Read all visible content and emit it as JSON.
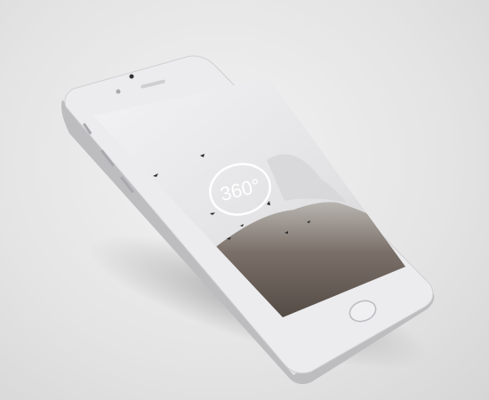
{
  "screen": {
    "badge_text": "360°"
  },
  "colors": {
    "body": "#e8e8ea",
    "bezel": "#f4f4f5",
    "sky": "#e9e9eb",
    "mountain": "#6e645e"
  }
}
